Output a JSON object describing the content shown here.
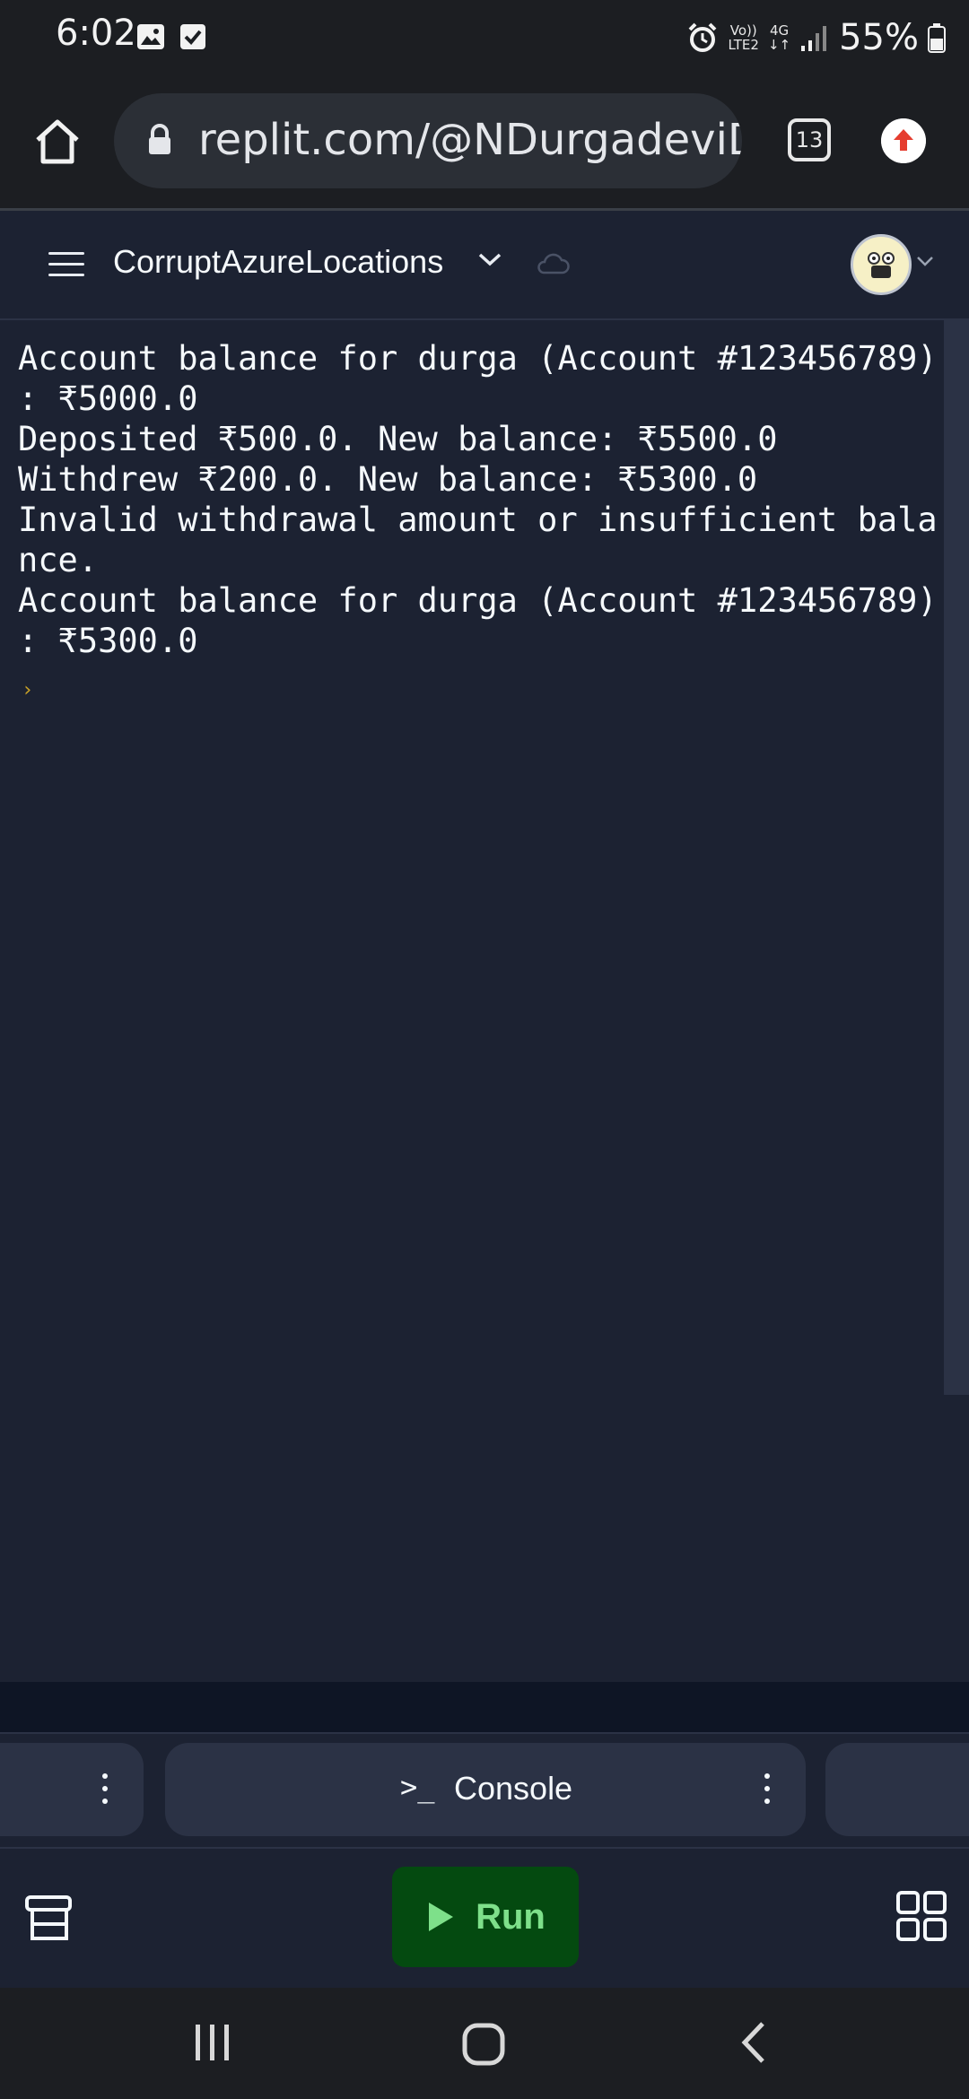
{
  "status_bar": {
    "time": "6:02",
    "battery": "55%",
    "network_volte": "Vo))",
    "network_lte": "LTE2",
    "network_4g": "4G"
  },
  "browser": {
    "url": "replit.com/@NDurgadeviDurg",
    "tab_count": "13"
  },
  "app_header": {
    "repl_name": "CorruptAzureLocations"
  },
  "console": {
    "lines": [
      "Account balance for durga (Account #123456789)",
      ": ₹5000.0",
      "Deposited ₹500.0. New balance: ₹5500.0",
      "Withdrew ₹200.0. New balance: ₹5300.0",
      "Invalid withdrawal amount or insufficient bala",
      "nce.",
      "Account balance for durga (Account #123456789)",
      ": ₹5300.0"
    ],
    "prompt": "›"
  },
  "tabs": {
    "console_icon": ">_",
    "console_label": "Console"
  },
  "toolbar": {
    "run_label": "Run"
  },
  "colors": {
    "background": "#1c2232",
    "run_button_bg": "#044a10",
    "run_button_fg": "#7ee08a",
    "prompt": "#c9a227"
  },
  "icons": [
    "home-icon",
    "lock-icon",
    "tabs-icon",
    "update-icon",
    "menu-icon",
    "chevron-down-icon",
    "cloud-icon",
    "avatar",
    "files-icon",
    "play-icon",
    "grid-icon",
    "recents-icon",
    "nav-home-icon",
    "back-icon"
  ]
}
